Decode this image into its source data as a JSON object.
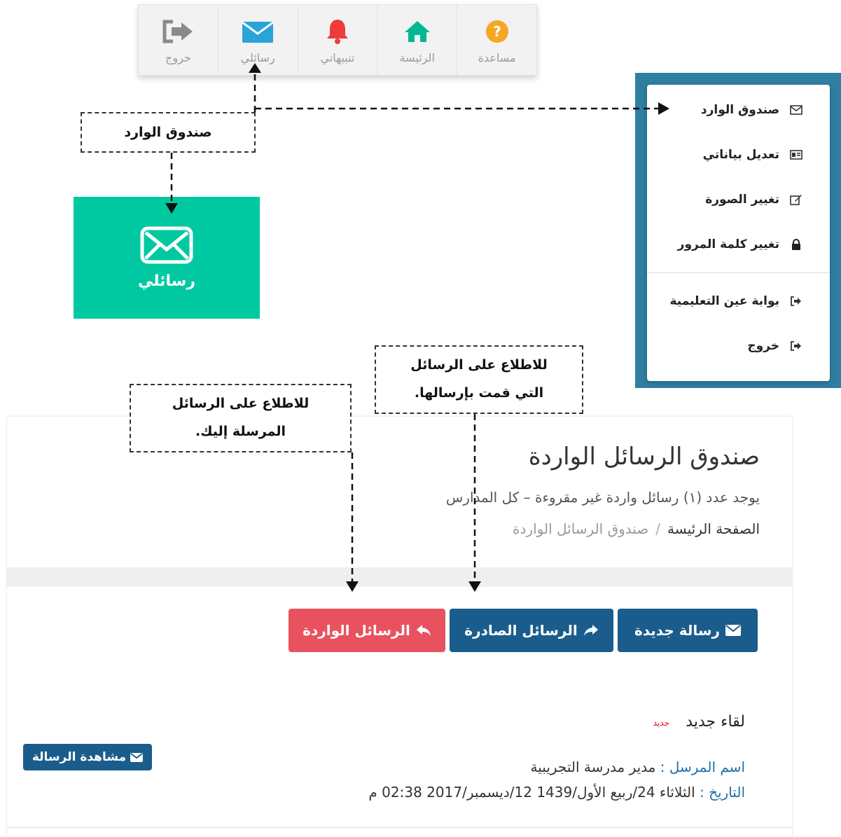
{
  "toolbar": {
    "items": [
      {
        "label": "مساعدة",
        "icon": "help-icon",
        "color": "#f5a623"
      },
      {
        "label": "الرئيسة",
        "icon": "home-icon",
        "color": "#00b894"
      },
      {
        "label": "تنبيهاتي",
        "icon": "bell-icon",
        "color": "#ef3b3b"
      },
      {
        "label": "رسائلي",
        "icon": "envelope-icon",
        "color": "#2aa3d8"
      },
      {
        "label": "خروج",
        "icon": "sign-out-icon",
        "color": "#9a9a9a"
      }
    ]
  },
  "menu": {
    "items": [
      {
        "label": "صندوق الوارد",
        "icon": "envelope-outline-icon"
      },
      {
        "label": "تعديل بياناتي",
        "icon": "id-card-icon"
      },
      {
        "label": "تغيير الصورة",
        "icon": "edit-icon"
      },
      {
        "label": "تغيير كلمة المرور",
        "icon": "lock-icon"
      }
    ],
    "items2": [
      {
        "label": "بوابة عين التعليمية",
        "icon": "sign-in-icon"
      },
      {
        "label": "خروج",
        "icon": "sign-out-icon"
      }
    ]
  },
  "notes": {
    "inbox": "صندوق الوارد",
    "sent_line1": "للاطلاع على الرسائل",
    "sent_line2": "التي قمت بإرسالها.",
    "received_line1": "للاطلاع على الرسائل",
    "received_line2": "المرسلة إليك."
  },
  "tile": {
    "label": "رسائلي",
    "color": "#00c9a1"
  },
  "page": {
    "title": "صندوق الرسائل الواردة",
    "subtitle": "يوجد عدد (١) رسائل واردة غير مقروءة – كل المدارس",
    "breadcrumb_home": "الصفحة الرئيسة",
    "breadcrumb_sep": "/",
    "breadcrumb_current": "صندوق الرسائل الواردة"
  },
  "buttons": {
    "new_message": "رسالة جديدة",
    "sent": "الرسائل الصادرة",
    "inbox": "الرسائل الواردة"
  },
  "message": {
    "title": "لقاء جديد",
    "badge": "جديد",
    "view_label": "مشاهدة الرسالة",
    "sender_label": "اسم المرسل :",
    "sender_value": "مدير مدرسة التجريبية",
    "date_label": "التاريخ :",
    "date_value": "الثلاثاء 24/ربيع الأول/1439   12/ديسمبر/2017 02:38 م"
  }
}
